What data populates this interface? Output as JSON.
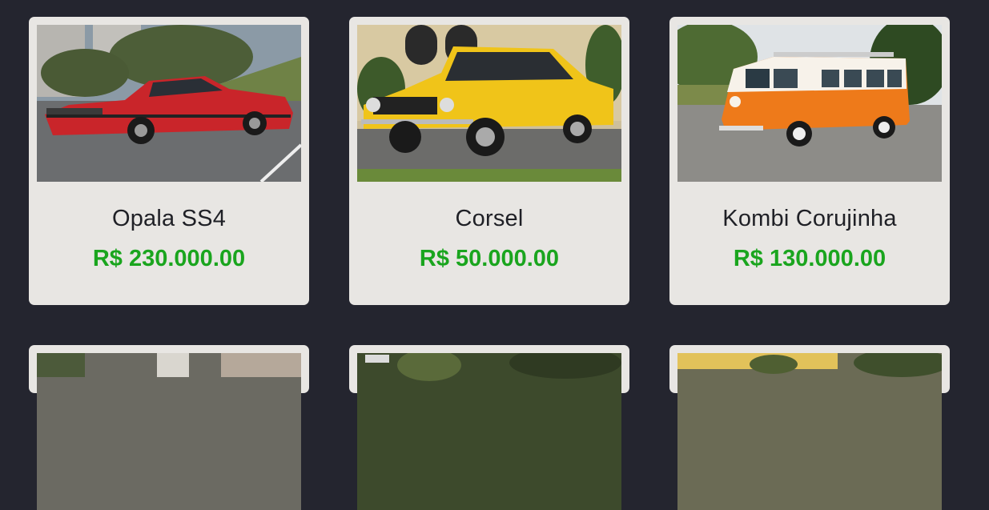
{
  "cars": [
    {
      "name": "Opala SS4",
      "price": "R$ 230.000.00",
      "photo": "red-muscle-car-photo"
    },
    {
      "name": "Corsel",
      "price": "R$ 50.000.00",
      "photo": "yellow-classic-car-photo"
    },
    {
      "name": "Kombi Corujinha",
      "price": "R$ 130.000.00",
      "photo": "orange-vw-van-photo"
    }
  ],
  "colors": {
    "background": "#24252f",
    "card": "#e8e6e3",
    "title": "#1f2026",
    "price": "#1aa51e"
  }
}
